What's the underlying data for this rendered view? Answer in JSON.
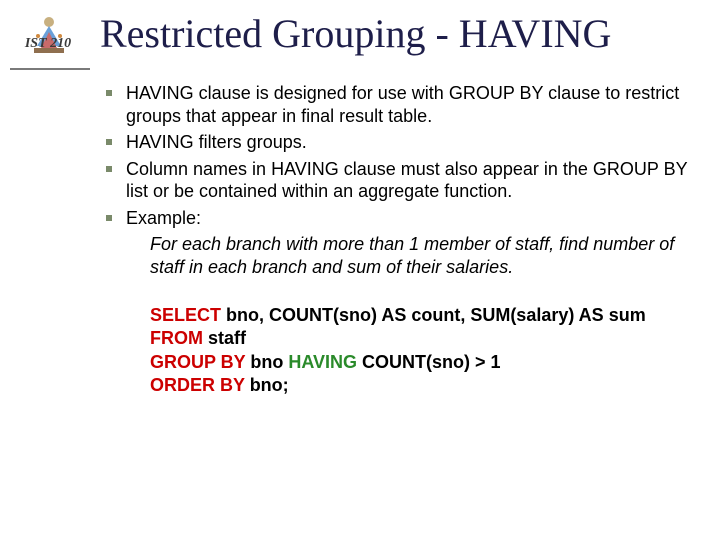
{
  "course": "IST 210",
  "title": "Restricted Grouping - HAVING",
  "bullets": [
    "HAVING clause is designed for use with GROUP BY clause to restrict groups that appear in final result table.",
    "HAVING filters groups.",
    "Column names in HAVING clause must also appear in the GROUP BY list or be contained within an aggregate function.",
    "Example:"
  ],
  "example_desc": "For each branch with more than 1 member of staff, find number of staff in each branch and sum of their salaries.",
  "sql": {
    "l1_kw": "SELECT",
    "l1_rest": " bno, COUNT(sno) AS count, SUM(salary) AS sum",
    "l2_kw": "FROM",
    "l2_rest": " staff",
    "l3_kw1": "GROUP BY",
    "l3_mid": " bno ",
    "l3_kw2": "HAVING",
    "l3_rest": " COUNT(sno) > 1",
    "l4_kw": "ORDER BY",
    "l4_rest": " bno;"
  }
}
